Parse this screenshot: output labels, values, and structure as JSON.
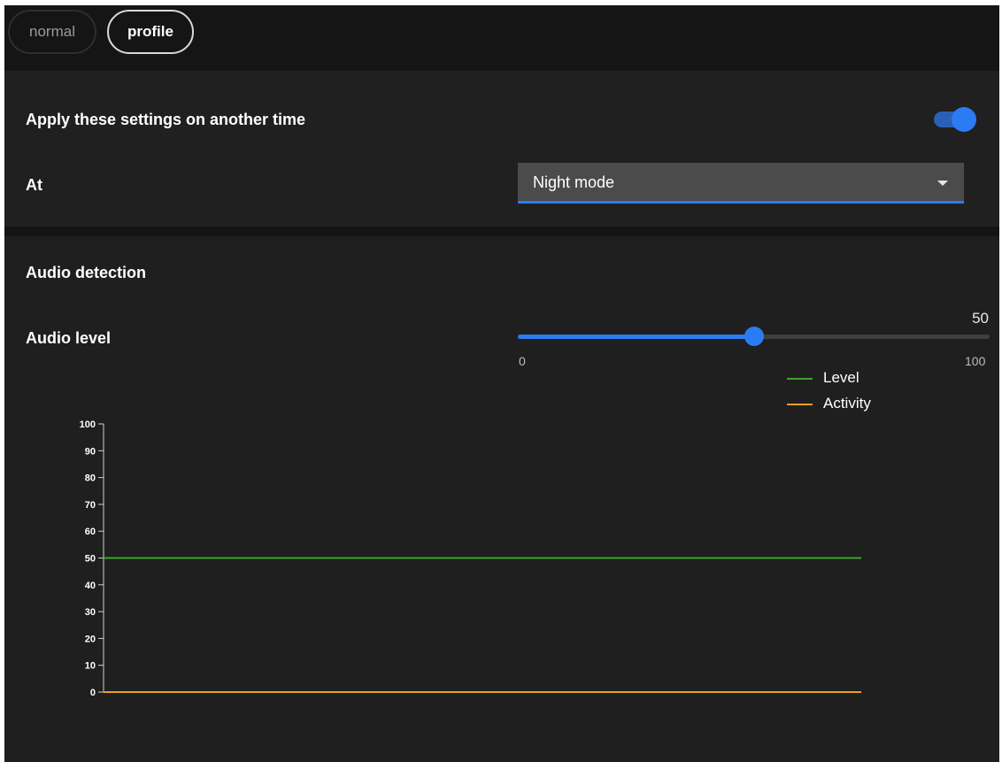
{
  "tabs": [
    {
      "label": "normal",
      "active": false
    },
    {
      "label": "profile",
      "active": true
    }
  ],
  "schedule": {
    "apply_label": "Apply these settings on another time",
    "apply_enabled": true,
    "at_label": "At",
    "at_value": "Night mode"
  },
  "audio": {
    "section_title": "Audio detection",
    "level_label": "Audio level",
    "level_value": "50",
    "level_min": "0",
    "level_max": "100"
  },
  "colors": {
    "accent": "#2b7cf3",
    "level": "#3ba52a",
    "activity": "#e8a026"
  },
  "chart_data": {
    "type": "line",
    "title": "",
    "xlabel": "",
    "ylabel": "",
    "ylim": [
      0,
      100
    ],
    "yticks": [
      "0",
      "10",
      "20",
      "30",
      "40",
      "50",
      "60",
      "70",
      "80",
      "90",
      "100"
    ],
    "legend_position": "top-right",
    "series": [
      {
        "name": "Level",
        "color": "#3ba52a",
        "values": [
          50,
          50
        ]
      },
      {
        "name": "Activity",
        "color": "#e8a026",
        "values": [
          0,
          0
        ]
      }
    ]
  }
}
